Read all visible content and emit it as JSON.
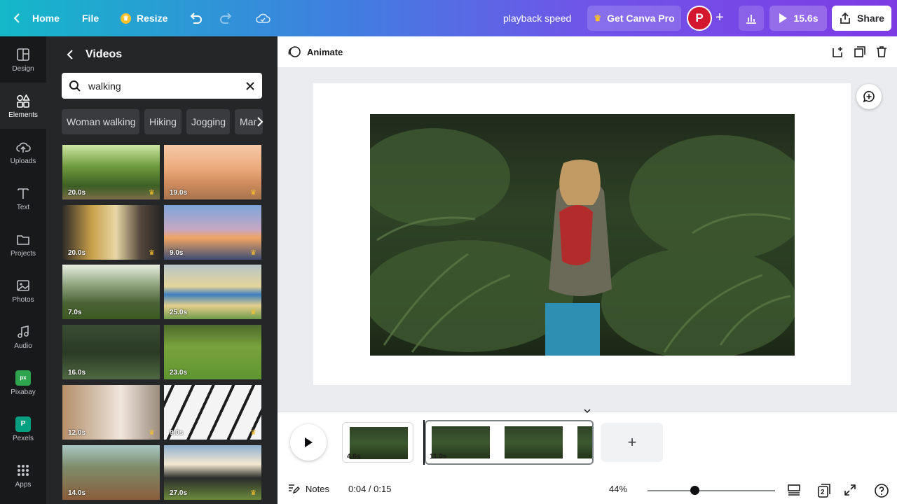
{
  "topbar": {
    "home_label": "Home",
    "file_label": "File",
    "resize_label": "Resize",
    "design_title": "playback speed",
    "get_pro_label": "Get Canva Pro",
    "avatar_letter": "P",
    "play_duration": "15.6s",
    "share_label": "Share",
    "crown_color": "#f8c12c"
  },
  "rail": {
    "items": [
      {
        "label": "Design",
        "icon": "layout-icon"
      },
      {
        "label": "Elements",
        "icon": "shapes-icon"
      },
      {
        "label": "Uploads",
        "icon": "cloud-upload-icon"
      },
      {
        "label": "Text",
        "icon": "text-icon"
      },
      {
        "label": "Projects",
        "icon": "folder-icon"
      },
      {
        "label": "Photos",
        "icon": "image-icon"
      },
      {
        "label": "Audio",
        "icon": "music-icon"
      },
      {
        "label": "Pixabay",
        "icon": "pixabay-icon"
      },
      {
        "label": "Pexels",
        "icon": "pexels-icon"
      },
      {
        "label": "Apps",
        "icon": "grid-icon"
      }
    ]
  },
  "panel": {
    "title": "Videos",
    "search_value": "walking",
    "chips": [
      "Woman walking",
      "Hiking",
      "Jogging",
      "Mar"
    ],
    "videos": [
      {
        "duration": "20.0s"
      },
      {
        "duration": "19.0s"
      },
      {
        "duration": "20.0s"
      },
      {
        "duration": "9.0s"
      },
      {
        "duration": "7.0s"
      },
      {
        "duration": "25.0s"
      },
      {
        "duration": "16.0s"
      },
      {
        "duration": "23.0s"
      },
      {
        "duration": "12.0s"
      },
      {
        "duration": "9.0s"
      },
      {
        "duration": "14.0s"
      },
      {
        "duration": "27.0s"
      }
    ]
  },
  "editor": {
    "animate_label": "Animate"
  },
  "timeline": {
    "clips": [
      {
        "duration": "4.6s"
      },
      {
        "duration": "11.0s"
      }
    ]
  },
  "bottombar": {
    "notes_label": "Notes",
    "time": "0:04 / 0:15",
    "zoom": "44%",
    "zoom_fraction": 0.37,
    "page_count": "2"
  }
}
